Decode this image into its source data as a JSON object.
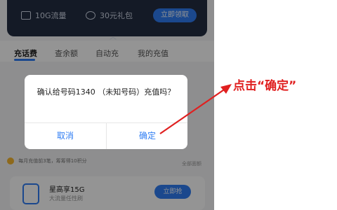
{
  "phone": {
    "benefits": [
      {
        "label": "10G流量",
        "icon": "data-card-icon"
      },
      {
        "label": "30元礼包",
        "icon": "gift-icon"
      }
    ],
    "claim_button": "立即领取",
    "tabs": [
      "充话费",
      "查余额",
      "自动充",
      "我的充值"
    ],
    "info_text": "每月充值前3笔，筹筹得10积分",
    "info_right": "全部面额",
    "card": {
      "title": "星高享15G",
      "subtitle": "大流量任性刷",
      "button": "立即抢"
    }
  },
  "dialog": {
    "message": "确认给号码1340          （未知号码）充值吗？",
    "cancel": "取消",
    "confirm": "确定"
  },
  "annotation": {
    "text": "点击“确定”",
    "color": "#e02020"
  },
  "colors": {
    "accent": "#2f7df3",
    "banner": "#232d42"
  }
}
